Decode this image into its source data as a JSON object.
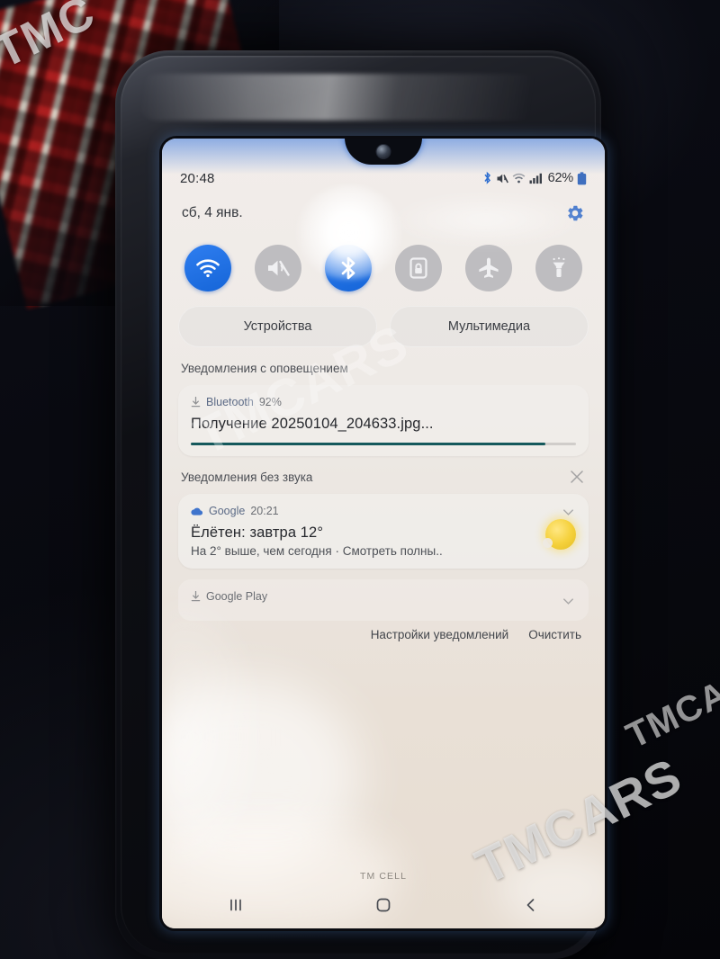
{
  "watermarks": {
    "top_left": "TMC",
    "middle": "TMCARS",
    "bottom_right": "TMCARS",
    "right": "TMCARS"
  },
  "statusbar": {
    "clock": "20:48",
    "battery_percent": "62%",
    "icons": [
      "bluetooth-icon",
      "mute-icon",
      "wifi-icon",
      "signal-icon",
      "battery-icon"
    ]
  },
  "date_row": {
    "date": "сб, 4 янв.",
    "settings_icon": "gear-icon"
  },
  "quick_settings": {
    "toggles": [
      {
        "name": "wifi",
        "icon": "wifi-icon",
        "state": "on"
      },
      {
        "name": "sound",
        "icon": "mute-icon",
        "state": "off"
      },
      {
        "name": "bluetooth",
        "icon": "bluetooth-icon",
        "state": "on"
      },
      {
        "name": "auto-rotate",
        "icon": "rotation-lock-icon",
        "state": "off"
      },
      {
        "name": "airplane-mode",
        "icon": "airplane-icon",
        "state": "off"
      },
      {
        "name": "flashlight",
        "icon": "flashlight-icon",
        "state": "off"
      }
    ],
    "pills": [
      {
        "label": "Устройства"
      },
      {
        "label": "Мультимедиа"
      }
    ]
  },
  "notifications": {
    "alerting_section_title": "Уведомления с оповещением",
    "silent_section_title": "Уведомления без звука",
    "silent_dismiss_icon": "close-icon",
    "bluetooth_transfer": {
      "app": "Bluetooth",
      "progress_label": "92%",
      "title": "Получение 20250104_204633.jpg...",
      "progress_percent": 92,
      "progress_color": "#15595c",
      "download_icon": "download-icon"
    },
    "google_weather": {
      "app": "Google",
      "time": "20:21",
      "title": "Ёлётен: завтра 12°",
      "body": "На 2° выше, чем сегодня · Смотреть полны..",
      "weather_icon": "sun-icon",
      "expand_icon": "chevron-down-icon"
    },
    "google_play": {
      "app": "Google Play",
      "download_icon": "download-icon",
      "expand_icon": "chevron-down-icon"
    },
    "actions": {
      "settings_label": "Настройки уведомлений",
      "clear_label": "Очистить"
    }
  },
  "footer": {
    "carrier": "TM CELL",
    "nav": [
      {
        "name": "recents",
        "icon": "recents-icon"
      },
      {
        "name": "home",
        "icon": "home-icon"
      },
      {
        "name": "back",
        "icon": "back-icon"
      }
    ]
  }
}
